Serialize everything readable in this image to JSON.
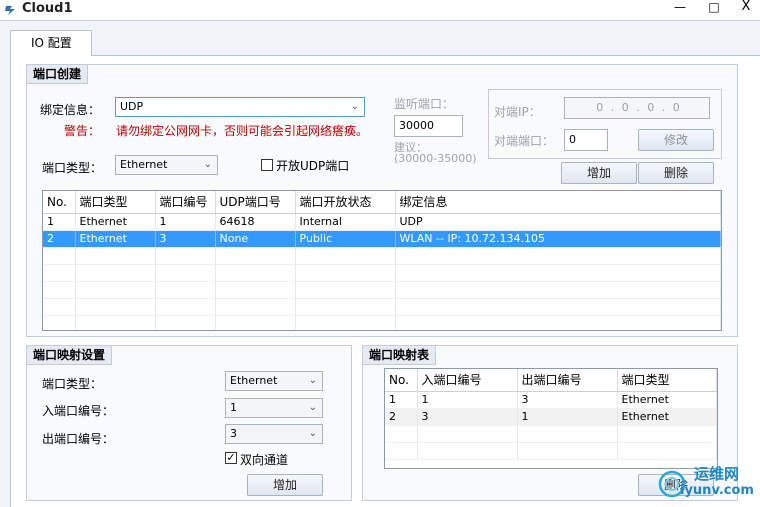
{
  "window": {
    "title": "Cloud1",
    "minimize_glyph": "—",
    "maximize_glyph": "□",
    "close_glyph": "X"
  },
  "tabs": [
    {
      "label": "IO 配置"
    }
  ],
  "port_create": {
    "title": "端口创建",
    "bind_label": "绑定信息：",
    "bind_value": "UDP",
    "warning_label": "警告：",
    "warning_text": "请勿绑定公网网卡，否则可能会引起网络瘩痪。",
    "listen_port_label": "监听端口：",
    "listen_port_value": "30000",
    "suggest_label": "建议：",
    "suggest_range": "(30000-35000)",
    "peer_ip_label": "对端IP：",
    "peer_ip_value": "0 . 0 . 0 . 0",
    "peer_port_label": "对端端口：",
    "peer_port_value": "0",
    "modify_button": "修改",
    "port_type_label": "端口类型：",
    "port_type_value": "Ethernet",
    "open_udp_label": "开放UDP端口",
    "add_button": "增加",
    "delete_button": "删除",
    "table": {
      "headers": [
        "No.",
        "端口类型",
        "端口编号",
        "UDP端口号",
        "端口开放状态",
        "绑定信息"
      ],
      "rows": [
        [
          "1",
          "Ethernet",
          "1",
          "64618",
          "Internal",
          "UDP"
        ],
        [
          "2",
          "Ethernet",
          "3",
          "None",
          "Public",
          "WLAN -- IP: 10.72.134.105"
        ]
      ]
    }
  },
  "port_map_settings": {
    "title": "端口映射设置",
    "port_type_label": "端口类型：",
    "port_type_value": "Ethernet",
    "in_port_label": "入端口编号：",
    "in_port_value": "1",
    "out_port_label": "出端口编号：",
    "out_port_value": "3",
    "bidirectional_label": "双向通道",
    "add_button": "增加"
  },
  "port_map_table": {
    "title": "端口映射表",
    "headers": [
      "No.",
      "入端口编号",
      "出端口编号",
      "端口类型"
    ],
    "rows": [
      [
        "1",
        "1",
        "3",
        "Ethernet"
      ],
      [
        "2",
        "3",
        "1",
        "Ethernet"
      ]
    ],
    "delete_button": "删除"
  },
  "watermark": {
    "text1": "运维网",
    "text2": "iyunv.com"
  }
}
